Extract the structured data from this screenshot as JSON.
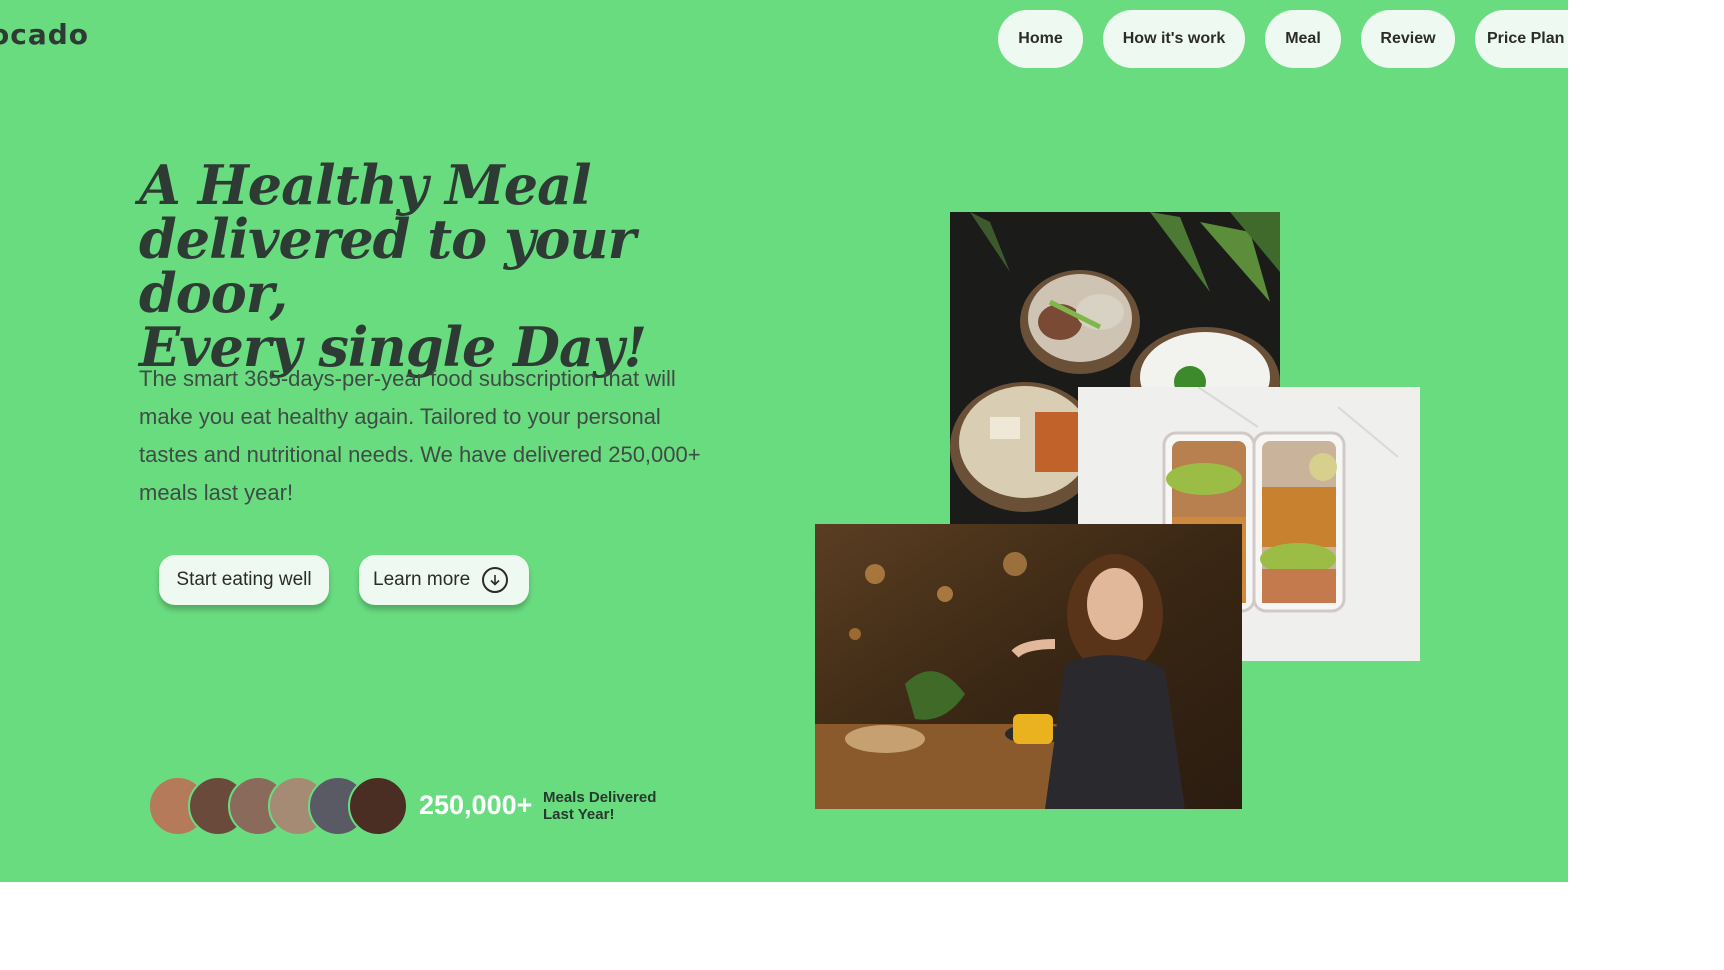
{
  "brand": {
    "logo_text": "ocado"
  },
  "nav": {
    "items": [
      {
        "label": "Home"
      },
      {
        "label": "How it's work"
      },
      {
        "label": "Meal"
      },
      {
        "label": "Review"
      },
      {
        "label": "Price Plan"
      }
    ]
  },
  "hero": {
    "headline_lines": [
      "A Healthy Meal",
      "delivered to your door,",
      "Every single Day!"
    ],
    "description": "The smart 365-days-per-year food subscription that will make you eat healthy again. Tailored to your personal tastes and nutritional needs. We have delivered 250,000+ meals last year!",
    "cta_primary": "Start eating well",
    "cta_secondary": "Learn more"
  },
  "stats": {
    "count": "250,000+",
    "label_line1": "Meals Delivered",
    "label_line2": "Last Year!"
  },
  "colors": {
    "hero_bg": "#6adc80",
    "button_bg": "#eefaf1",
    "text_dark": "#2e3a34"
  },
  "icons": {
    "learn_more": "arrow-down-circle-icon"
  }
}
